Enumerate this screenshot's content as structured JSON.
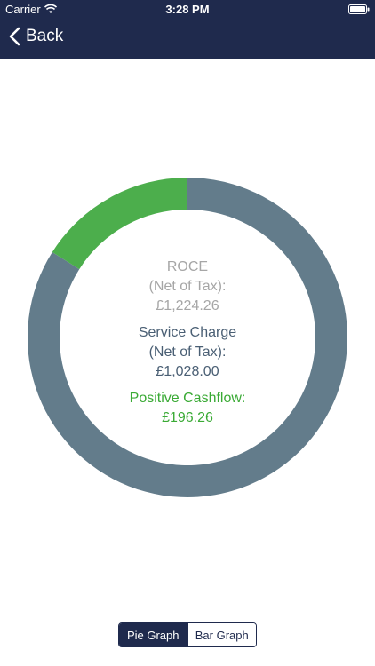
{
  "status_bar": {
    "carrier": "Carrier",
    "time": "3:28 PM"
  },
  "nav": {
    "back_label": "Back"
  },
  "chart_data": {
    "type": "pie",
    "style": "donut",
    "series": [
      {
        "name": "Service Charge (Net of Tax)",
        "value": 1028.0,
        "color": "#637c8b"
      },
      {
        "name": "Positive Cashflow",
        "value": 196.26,
        "color": "#4cae4c"
      }
    ],
    "center_labels": {
      "roce_title": "ROCE",
      "roce_sub": "(Net of Tax):",
      "roce_value": "£1,224.26",
      "service_title": "Service Charge",
      "service_sub": "(Net of Tax):",
      "service_value": "£1,028.00",
      "cashflow_title": "Positive Cashflow:",
      "cashflow_value": "£196.26"
    }
  },
  "segmented_control": {
    "options": [
      "Pie Graph",
      "Bar Graph"
    ],
    "selected": "Pie Graph"
  },
  "colors": {
    "nav_bg": "#1f2a4d",
    "accent_green": "#4cae4c",
    "slate": "#637c8b"
  }
}
